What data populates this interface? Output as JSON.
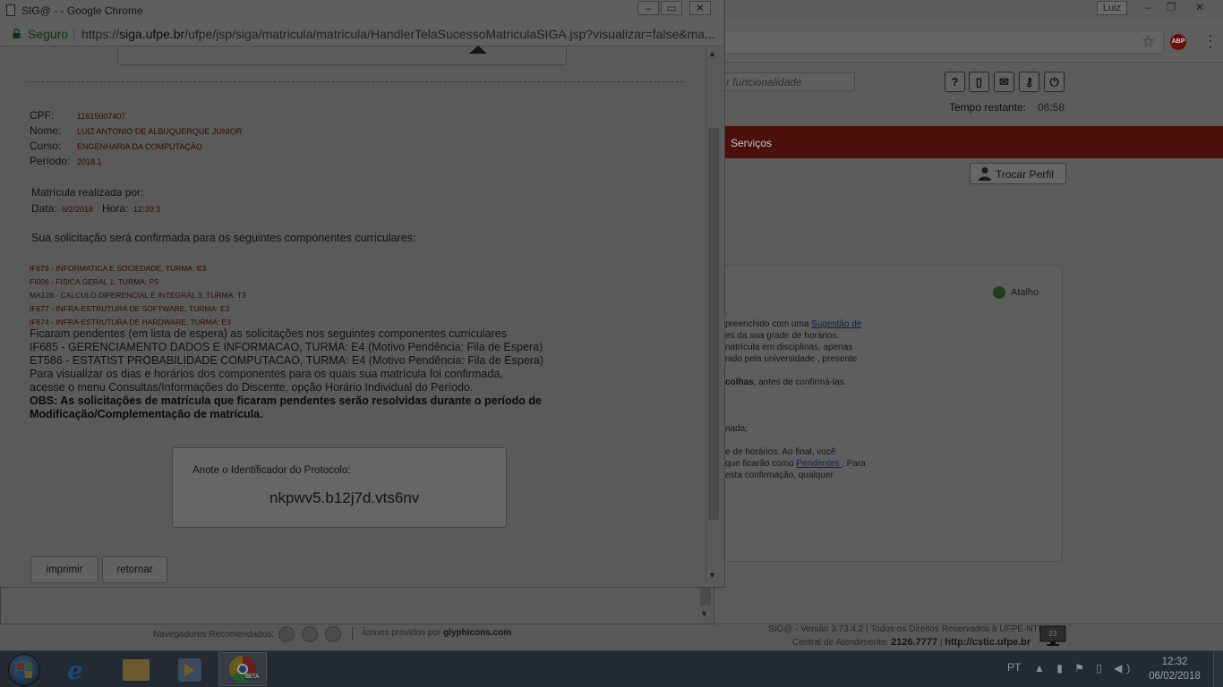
{
  "background": {
    "user_badge": "Luiz",
    "search_placeholder": "r funcionalidade",
    "timer_label": "Tempo restante:",
    "timer_value": "06:58",
    "nav_servicos": "Serviços",
    "trocar_perfil": "Trocar Perfil",
    "atalho": "Atalho",
    "panel_lines": [
      {
        "pre": ".",
        "link": "",
        "post": ""
      },
      {
        "pre": " preenchido com uma ",
        "link": "Sugestão de",
        "post": ""
      },
      {
        "pre": "es da sua grade de horários.",
        "link": "",
        "post": ""
      },
      {
        "pre": "natrícula em disciplinas, apenas",
        "link": "",
        "post": ""
      },
      {
        "pre": "nido pela universidade , presente",
        "link": "",
        "post": ""
      },
      {
        "pre": "colhas",
        "link": "",
        "post": ", antes de confirmá-las."
      },
      {
        "pre": "nada;",
        "link": "",
        "post": ""
      },
      {
        "pre": "e de horários. Ao final, você",
        "link": "",
        "post": ""
      },
      {
        "pre": "que ficarão como ",
        "link": "Pendentes ",
        "post": ", Para"
      },
      {
        "pre": "esta confirmação, qualquer",
        "link": "",
        "post": ""
      }
    ],
    "footer": {
      "browsers_label": "Navegadores Recomendados:",
      "glyph_prefix": "Ícones providos por ",
      "glyph_site": "glyphicons.com",
      "version": "SIG@ - Versão 3.73.4.2 | Todos os Direitos Reservados à UFPE-NTI",
      "central_label": "Central de Atendimento: ",
      "central_phone": "2126.7777",
      "central_sep": " | ",
      "central_site": "http://cstic.ufpe.br",
      "monitor_badge": "23"
    }
  },
  "popup": {
    "window_title": "SIG@ - - Google Chrome",
    "secure_label": "Seguro",
    "url_prefix": "https://",
    "url_host": "siga.ufpe.br",
    "url_path": "/ufpe/jsp/siga/matricula/matricula/HandlerTelaSucessoMatriculaSIGA.jsp?visualizar=false&ma...",
    "fields": {
      "cpf_label": "CPF:",
      "cpf_value": "11615007407",
      "nome_label": "Nome:",
      "nome_value": "LUIZ ANTONIO DE ALBUQUERQUE JUNIOR",
      "curso_label": "Curso:",
      "curso_value": "ENGENHARIA DA COMPUTAÇÃO",
      "periodo_label": "Período:",
      "periodo_value": "2018.1"
    },
    "matricula_label": "Matrícula realizada por:",
    "data_label": "Data:",
    "data_value": "6/2/2018",
    "hora_label": "Hora:",
    "hora_value": "12:39:3",
    "intro": "Sua solicitação será confirmada para os seguintes componentes curriculares:",
    "courses": [
      "IF679 - INFORMATICA E SOCIEDADE, TURMA: E3",
      "FI006 - FISICA GERAL 1, TURMA: P5",
      "MA128 - CALCULO DIFERENCIAL E INTEGRAL 3, TURMA: T3",
      "IF677 - INFRA-ESTRUTURA DE SOFTWARE, TURMA: E3",
      "IF674 - INFRA-ESTRUTURA DE HARDWARE, TURMA: E3"
    ],
    "pending_lines": [
      "Ficaram pendentes (em lista de espera) as solicitações nos seguintes componentes curriculares",
      "IF685 - GERENCIAMENTO DADOS E INFORMACAO, TURMA: E4 (Motivo Pendência: Fila de Espera)",
      "ET586 - ESTATIST PROBABILIDADE COMPUTACAO, TURMA: E4 (Motivo Pendência: Fila de Espera)",
      " Para visualizar os dias e horários dos componentes para os quais sua matrícula foi confirmada,",
      "acesse o menu Consultas/Informações do Discente, opção Horário Individual do Período."
    ],
    "obs_lines": [
      "OBS: As solicitações de matrícula que ficaram pendentes serão resolvidas durante o período de",
      "Modificação/Complementação de matrícula."
    ],
    "protocol_label": "Anote o Identificador do Protocolo:",
    "protocol_id": "nkpwv5.b12j7d.vts6nv",
    "btn_imprimir": "imprimir",
    "btn_retornar": "retornar"
  },
  "taskbar": {
    "language": "PT",
    "time": "12:32",
    "date": "06/02/2018"
  }
}
